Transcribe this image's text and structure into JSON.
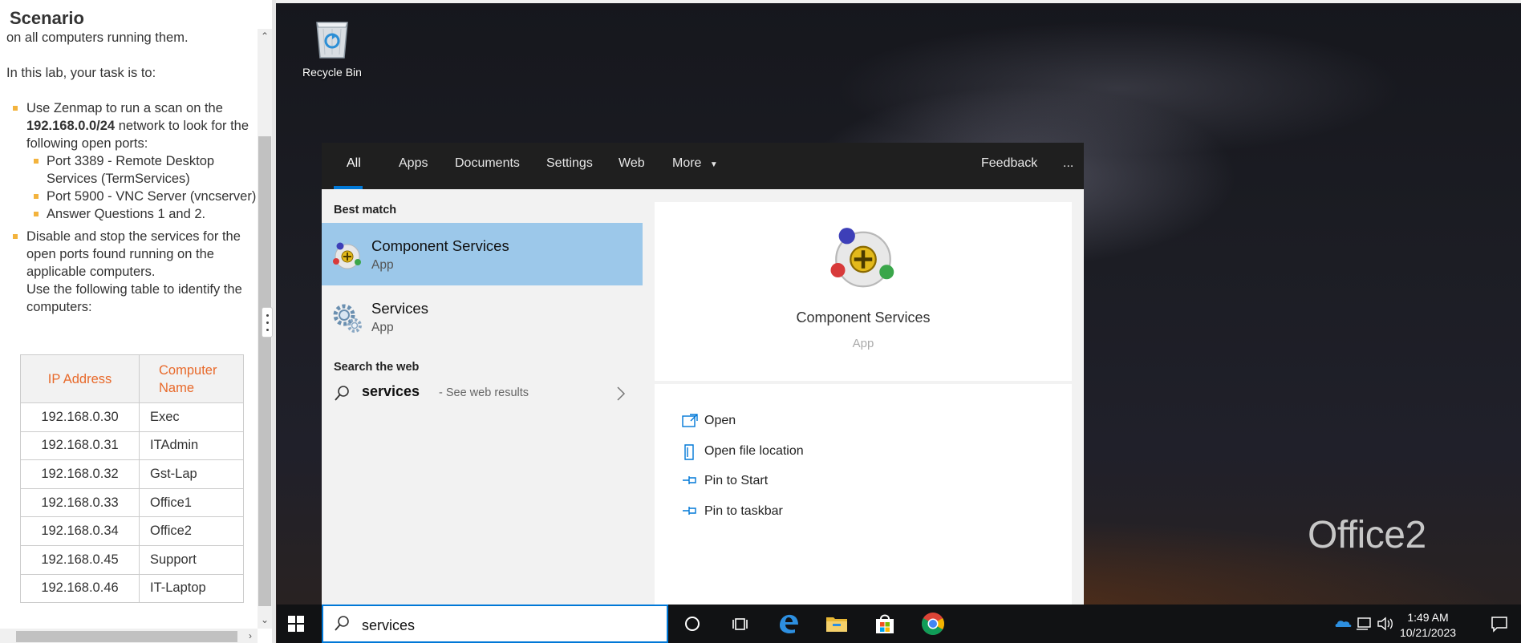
{
  "scenario": {
    "title": "Scenario",
    "intro_fragment": "on all computers running them.",
    "task_intro": "In this lab, your task is to:",
    "bullet1_pre": "Use Zenmap to run a scan on the",
    "bullet1_network": "192.168.0.0/24",
    "bullet1_post": "network to look for the following open ports:",
    "sub1": "Port 3389 - Remote Desktop Services (TermServices)",
    "sub2": "Port 5900 - VNC Server (vncserver)",
    "sub3": "Answer Questions 1 and 2.",
    "bullet2": "Disable and stop the services for the open ports found running on the applicable computers.",
    "bullet2_note": "Use the following table to identify the computers:",
    "table": {
      "headers": [
        "IP Address",
        "Computer Name"
      ],
      "rows": [
        [
          "192.168.0.30",
          "Exec"
        ],
        [
          "192.168.0.31",
          "ITAdmin"
        ],
        [
          "192.168.0.32",
          "Gst-Lap"
        ],
        [
          "192.168.0.33",
          "Office1"
        ],
        [
          "192.168.0.34",
          "Office2"
        ],
        [
          "192.168.0.45",
          "Support"
        ],
        [
          "192.168.0.46",
          "IT-Laptop"
        ]
      ]
    }
  },
  "desktop": {
    "recycle_bin_label": "Recycle Bin",
    "watermark": "Office2"
  },
  "search": {
    "tabs": {
      "all": "All",
      "apps": "Apps",
      "documents": "Documents",
      "settings": "Settings",
      "web": "Web",
      "more": "More",
      "feedback": "Feedback",
      "overflow": "..."
    },
    "best_match_label": "Best match",
    "results": [
      {
        "title": "Component Services",
        "type": "App",
        "icon": "component-services-icon"
      },
      {
        "title": "Services",
        "type": "App",
        "icon": "services-gear-icon"
      }
    ],
    "web_section_label": "Search the web",
    "web_query": "services",
    "web_hint": "- See web results",
    "preview": {
      "title": "Component Services",
      "type": "App",
      "actions": [
        "Open",
        "Open file location",
        "Pin to Start",
        "Pin to taskbar"
      ]
    }
  },
  "taskbar": {
    "search_text": "services",
    "time": "1:49 AM",
    "date": "10/21/2023",
    "accent": "#0078d7"
  }
}
